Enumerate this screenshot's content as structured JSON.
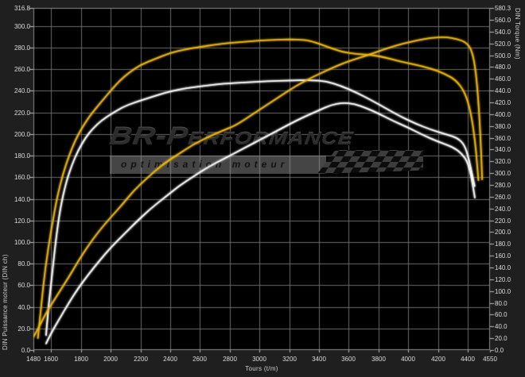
{
  "axes": {
    "left": {
      "title": "DIN Puissance moteur (DIN ch)",
      "max": 316.8,
      "tick_labels": [
        "316.8",
        "300.0",
        "280.0",
        "260.0",
        "240.0",
        "220.0",
        "200.0",
        "180.0",
        "160.0",
        "140.0",
        "120.0",
        "100.0",
        "80.0",
        "60.0",
        "40.0",
        "20.0",
        "0.0"
      ],
      "tick_values": [
        316.8,
        300,
        280,
        260,
        240,
        220,
        200,
        180,
        160,
        140,
        120,
        100,
        80,
        60,
        40,
        20,
        0
      ]
    },
    "right": {
      "title": "DIN Torque (Nm)",
      "max": 580.3,
      "tick_labels": [
        "580.3",
        "560.0",
        "540.0",
        "520.0",
        "500.0",
        "480.0",
        "460.0",
        "440.0",
        "420.0",
        "400.0",
        "380.0",
        "360.0",
        "340.0",
        "320.0",
        "300.0",
        "280.0",
        "260.0",
        "240.0",
        "220.0",
        "200.0",
        "180.0",
        "160.0",
        "140.0",
        "120.0",
        "100.0",
        "80.0",
        "60.0",
        "40.0",
        "20.0",
        "0.0"
      ],
      "tick_values": [
        580.3,
        560,
        540,
        520,
        500,
        480,
        460,
        440,
        420,
        400,
        380,
        360,
        340,
        320,
        300,
        280,
        260,
        240,
        220,
        200,
        180,
        160,
        140,
        120,
        100,
        80,
        60,
        40,
        20,
        0
      ]
    },
    "x": {
      "title": "Tours (t/m)",
      "min": 1480,
      "max": 4550,
      "tick_labels": [
        "1480",
        "1600",
        "1800",
        "2000",
        "2200",
        "2400",
        "2600",
        "2800",
        "3000",
        "3200",
        "3400",
        "3600",
        "3800",
        "4000",
        "4200",
        "4400",
        "4550"
      ],
      "tick_values": [
        1480,
        1600,
        1800,
        2000,
        2200,
        2400,
        2600,
        2800,
        3000,
        3200,
        3400,
        3600,
        3800,
        4000,
        4200,
        4400,
        4550
      ],
      "gridline_values": [
        1600,
        1800,
        2000,
        2200,
        2400,
        2600,
        2800,
        3000,
        3200,
        3400,
        3600,
        3800,
        4000,
        4200,
        4400
      ]
    }
  },
  "watermark": {
    "brand": "BR-Performance",
    "tagline": "optimisation moteur"
  },
  "colors": {
    "outer_background": "#1f1f1f",
    "plot_background": "#000000",
    "grid": "#6a6a6a",
    "plot_border": "#8d8d8d",
    "tick_dash": "#bdbdbd",
    "curve_tuned": "#eeba0a",
    "curve_stock": "#ffffff"
  },
  "chart_data": {
    "type": "line",
    "x_unit": "Tours (t/m)",
    "grid": true,
    "legend": "none",
    "axis_ranges": {
      "left_power_ch": [
        0,
        316.8
      ],
      "right_torque_nm": [
        0,
        580.3
      ],
      "x_rpm": [
        1480,
        4550
      ]
    },
    "series": [
      {
        "name": "stock-torque",
        "color": "#ffffff",
        "axis": "right",
        "unit": "Nm",
        "peak": {
          "value": 458,
          "rpm": 3350
        },
        "points": [
          [
            1565,
            25
          ],
          [
            1580,
            70
          ],
          [
            1600,
            115
          ],
          [
            1630,
            185
          ],
          [
            1660,
            240
          ],
          [
            1700,
            285
          ],
          [
            1740,
            315
          ],
          [
            1780,
            338
          ],
          [
            1830,
            360
          ],
          [
            1880,
            376
          ],
          [
            1940,
            390
          ],
          [
            2000,
            400
          ],
          [
            2080,
            412
          ],
          [
            2160,
            420
          ],
          [
            2260,
            428
          ],
          [
            2360,
            436
          ],
          [
            2460,
            442
          ],
          [
            2560,
            446
          ],
          [
            2660,
            449
          ],
          [
            2760,
            452
          ],
          [
            2900,
            454
          ],
          [
            3050,
            456
          ],
          [
            3200,
            457
          ],
          [
            3350,
            458
          ],
          [
            3450,
            456
          ],
          [
            3550,
            448
          ],
          [
            3650,
            437
          ],
          [
            3750,
            424
          ],
          [
            3850,
            410
          ],
          [
            3950,
            396
          ],
          [
            4050,
            384
          ],
          [
            4150,
            374
          ],
          [
            4250,
            366
          ],
          [
            4330,
            360
          ],
          [
            4380,
            348
          ],
          [
            4410,
            322
          ],
          [
            4435,
            292
          ],
          [
            4447,
            278
          ]
        ]
      },
      {
        "name": "stock-power",
        "color": "#ffffff",
        "axis": "left",
        "unit": "DIN ch",
        "peak": {
          "value": 230,
          "rpm": 3560
        },
        "points": [
          [
            1565,
            6
          ],
          [
            1600,
            16
          ],
          [
            1660,
            30
          ],
          [
            1720,
            44
          ],
          [
            1780,
            57
          ],
          [
            1850,
            70
          ],
          [
            1920,
            82
          ],
          [
            2000,
            95
          ],
          [
            2080,
            106
          ],
          [
            2160,
            117
          ],
          [
            2260,
            130
          ],
          [
            2360,
            141
          ],
          [
            2460,
            152
          ],
          [
            2560,
            161
          ],
          [
            2660,
            170
          ],
          [
            2760,
            177
          ],
          [
            2870,
            185
          ],
          [
            2980,
            193
          ],
          [
            3090,
            201
          ],
          [
            3200,
            209
          ],
          [
            3300,
            216
          ],
          [
            3400,
            222
          ],
          [
            3480,
            227
          ],
          [
            3560,
            229
          ],
          [
            3640,
            228
          ],
          [
            3720,
            224
          ],
          [
            3800,
            219
          ],
          [
            3900,
            212
          ],
          [
            4000,
            206
          ],
          [
            4100,
            199
          ],
          [
            4200,
            193
          ],
          [
            4300,
            188
          ],
          [
            4360,
            182
          ],
          [
            4400,
            174
          ],
          [
            4425,
            160
          ],
          [
            4440,
            148
          ],
          [
            4448,
            141
          ]
        ]
      },
      {
        "name": "tuned-torque",
        "color": "#eeba0a",
        "axis": "right",
        "unit": "Nm",
        "peak": {
          "value": 527,
          "rpm": 3200
        },
        "points": [
          [
            1510,
            20
          ],
          [
            1530,
            70
          ],
          [
            1560,
            140
          ],
          [
            1600,
            205
          ],
          [
            1640,
            260
          ],
          [
            1680,
            300
          ],
          [
            1720,
            330
          ],
          [
            1760,
            355
          ],
          [
            1800,
            374
          ],
          [
            1850,
            394
          ],
          [
            1900,
            410
          ],
          [
            1950,
            425
          ],
          [
            2000,
            440
          ],
          [
            2060,
            457
          ],
          [
            2120,
            470
          ],
          [
            2200,
            484
          ],
          [
            2300,
            494
          ],
          [
            2400,
            504
          ],
          [
            2500,
            510
          ],
          [
            2600,
            514
          ],
          [
            2700,
            518
          ],
          [
            2800,
            521
          ],
          [
            2900,
            523
          ],
          [
            3000,
            525
          ],
          [
            3100,
            526
          ],
          [
            3200,
            527
          ],
          [
            3300,
            526
          ],
          [
            3350,
            524
          ],
          [
            3450,
            515
          ],
          [
            3550,
            506
          ],
          [
            3650,
            502
          ],
          [
            3750,
            501
          ],
          [
            3850,
            496
          ],
          [
            3950,
            489
          ],
          [
            4050,
            484
          ],
          [
            4150,
            478
          ],
          [
            4250,
            468
          ],
          [
            4320,
            458
          ],
          [
            4380,
            438
          ],
          [
            4420,
            405
          ],
          [
            4450,
            355
          ],
          [
            4465,
            310
          ],
          [
            4472,
            288
          ]
        ]
      },
      {
        "name": "tuned-power",
        "color": "#eeba0a",
        "axis": "left",
        "unit": "DIN ch",
        "peak": {
          "value": 290,
          "rpm": 4250
        },
        "points": [
          [
            1480,
            12
          ],
          [
            1520,
            22
          ],
          [
            1560,
            33
          ],
          [
            1600,
            42
          ],
          [
            1660,
            55
          ],
          [
            1720,
            68
          ],
          [
            1780,
            82
          ],
          [
            1850,
            97
          ],
          [
            1920,
            110
          ],
          [
            2000,
            123
          ],
          [
            2080,
            135
          ],
          [
            2150,
            147
          ],
          [
            2250,
            160
          ],
          [
            2350,
            172
          ],
          [
            2450,
            181
          ],
          [
            2550,
            190
          ],
          [
            2650,
            197
          ],
          [
            2750,
            203
          ],
          [
            2840,
            208
          ],
          [
            2950,
            218
          ],
          [
            3050,
            227
          ],
          [
            3150,
            236
          ],
          [
            3250,
            245
          ],
          [
            3360,
            253
          ],
          [
            3470,
            260
          ],
          [
            3570,
            266
          ],
          [
            3680,
            271
          ],
          [
            3770,
            275
          ],
          [
            3870,
            280
          ],
          [
            3970,
            284
          ],
          [
            4070,
            287
          ],
          [
            4150,
            289
          ],
          [
            4250,
            290
          ],
          [
            4330,
            288
          ],
          [
            4390,
            285
          ],
          [
            4430,
            277
          ],
          [
            4455,
            258
          ],
          [
            4475,
            225
          ],
          [
            4490,
            185
          ],
          [
            4497,
            158
          ]
        ]
      }
    ]
  }
}
